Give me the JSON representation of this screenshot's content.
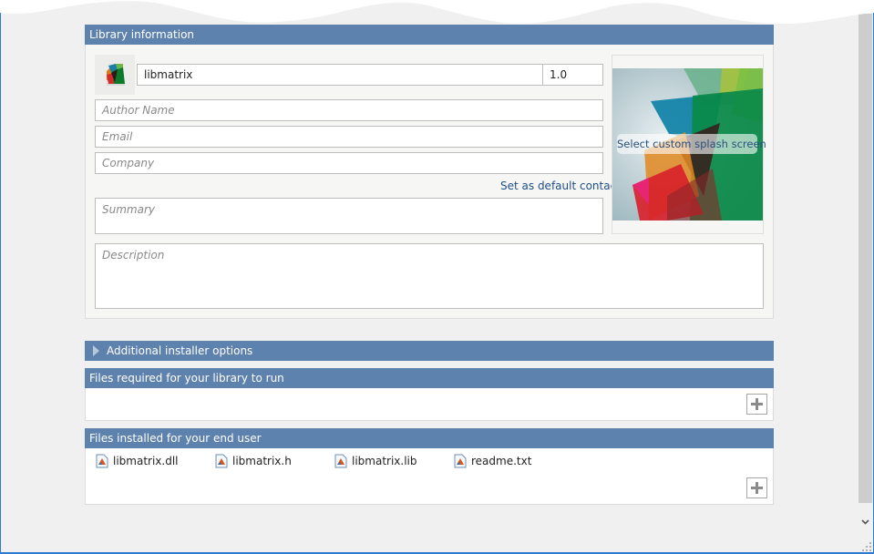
{
  "library_info": {
    "header": "Library information",
    "icon": "matlab-toolbox-icon",
    "name_value": "libmatrix",
    "version_value": "1.0",
    "author_placeholder": "Author Name",
    "email_placeholder": "Email",
    "company_placeholder": "Company",
    "default_contact_link": "Set as default contact",
    "summary_placeholder": "Summary",
    "description_placeholder": "Description",
    "splash_label": "Select custom splash screen"
  },
  "additional_options": {
    "header": "Additional installer options",
    "icon": "expand-triangle-icon"
  },
  "files_required": {
    "header": "Files required for your library to run",
    "items": [],
    "add_icon": "plus-icon"
  },
  "files_installed": {
    "header": "Files installed for your end user",
    "items": [
      {
        "name": "libmatrix.dll",
        "icon": "matlab-file-icon"
      },
      {
        "name": "libmatrix.h",
        "icon": "matlab-file-icon"
      },
      {
        "name": "libmatrix.lib",
        "icon": "matlab-file-icon"
      },
      {
        "name": "readme.txt",
        "icon": "matlab-file-icon"
      }
    ],
    "add_icon": "plus-icon"
  },
  "colors": {
    "section_header": "#5e82ae",
    "link": "#1f4f8a",
    "window_border": "#2c7bd0",
    "background": "#f0f0f0"
  }
}
